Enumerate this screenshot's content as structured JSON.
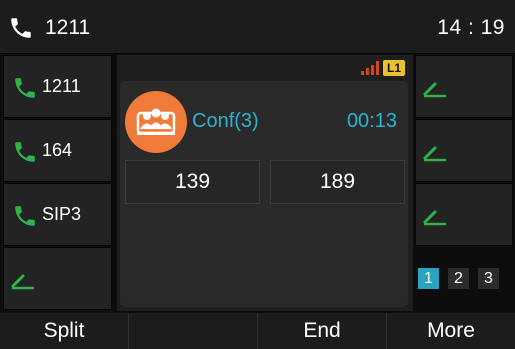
{
  "topbar": {
    "account": "1211",
    "time": "14 : 19",
    "phone_icon": "phone-icon"
  },
  "left_keys": [
    {
      "label": "1211",
      "icon": "phone-icon"
    },
    {
      "label": "164",
      "icon": "phone-icon"
    },
    {
      "label": "SIP3",
      "icon": "phone-icon"
    },
    {
      "label": "",
      "icon": "line-key-icon"
    }
  ],
  "right_keys": [
    {
      "icon": "line-key-icon"
    },
    {
      "icon": "line-key-icon"
    },
    {
      "icon": "line-key-icon"
    }
  ],
  "status": {
    "line_badge": "L1",
    "signal_icon": "signal-bars-icon"
  },
  "conference": {
    "name": "Conf(3)",
    "duration": "00:13",
    "avatar_icon": "conference-group-icon",
    "parties": [
      "139",
      "189"
    ]
  },
  "pages": [
    "1",
    "2",
    "3"
  ],
  "active_page": "1",
  "softkeys": [
    "Split",
    "",
    "End",
    "More"
  ],
  "colors": {
    "accent_blue": "#2bb3cf",
    "phone_green": "#2fb348",
    "avatar_orange": "#f07b3b",
    "signal_red": "#d7441c",
    "badge_yellow": "#e8c232"
  }
}
